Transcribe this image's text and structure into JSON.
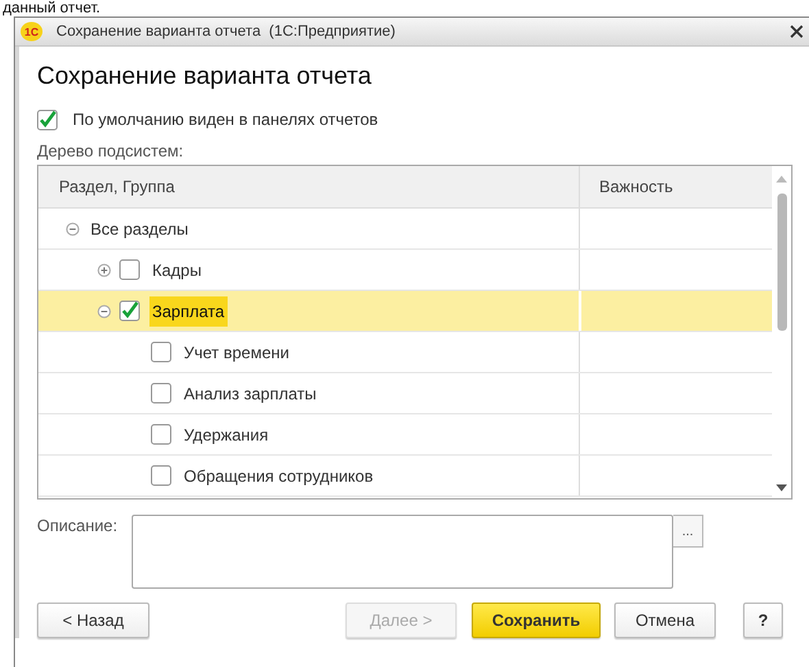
{
  "backdrop_text": "данный отчет.",
  "window": {
    "logo": "1С",
    "title": "Сохранение варианта отчета  (1С:Предприятие)"
  },
  "heading": "Сохранение варианта отчета",
  "default_visible": {
    "label": "По умолчанию виден в панелях отчетов",
    "checked": true
  },
  "tree_label": "Дерево подсистем:",
  "tree": {
    "columns": [
      "Раздел, Группа",
      "Важность"
    ],
    "rows": [
      {
        "label": "Все разделы",
        "expanded": true,
        "children": [
          {
            "label": "Кадры",
            "checked": false,
            "expanded": false,
            "selected": false
          },
          {
            "label": "Зарплата",
            "checked": true,
            "expanded": true,
            "selected": true,
            "children": [
              {
                "label": "Учет времени",
                "checked": false,
                "selected": false
              },
              {
                "label": "Анализ зарплаты",
                "checked": false,
                "selected": false
              },
              {
                "label": "Удержания",
                "checked": false,
                "selected": false
              },
              {
                "label": "Обращения сотрудников",
                "checked": false,
                "selected": false
              }
            ]
          }
        ]
      }
    ]
  },
  "description": {
    "label": "Описание:",
    "button": "..."
  },
  "buttons": [
    {
      "label": "< Назад",
      "kind": "normal",
      "disabled": false
    },
    {
      "label": "Далее >",
      "kind": "normal",
      "disabled": true
    },
    {
      "label": "Сохранить",
      "kind": "primary",
      "disabled": false
    },
    {
      "label": "Отмена",
      "kind": "normal",
      "disabled": false
    },
    {
      "label": "?",
      "kind": "help",
      "disabled": false
    }
  ]
}
